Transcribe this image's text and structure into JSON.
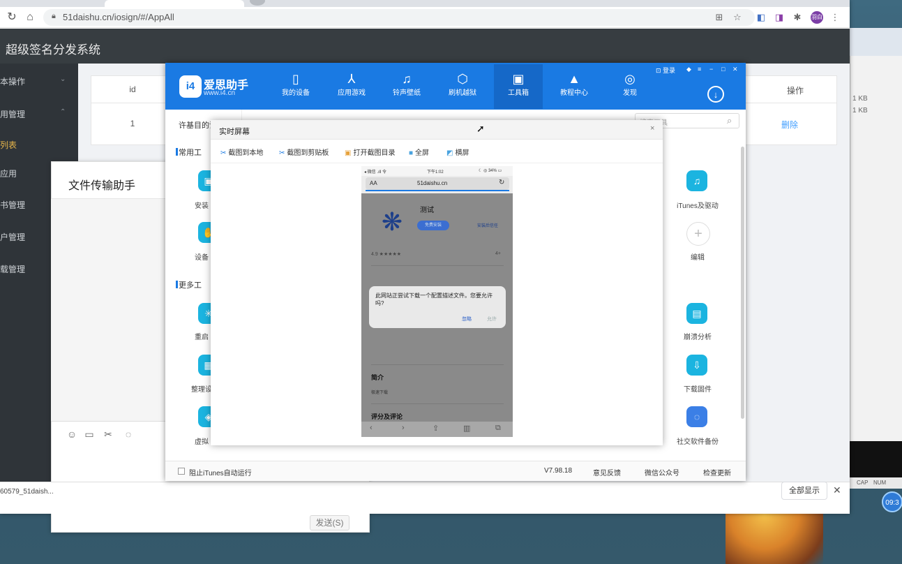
{
  "browser": {
    "url": "51daishu.cn/iosign/#/AppAll",
    "lock_icon": "lock-icon",
    "avatar_text": "羽白",
    "icons": [
      "back-icon",
      "reload-icon",
      "home-icon",
      "translate-icon",
      "star-icon",
      "extension-icon",
      "profile-icon",
      "menu-icon"
    ]
  },
  "web_app": {
    "title": "超级签名分发系统",
    "sidebar": [
      {
        "label": "本操作",
        "arrow": "⌄"
      },
      {
        "label": "用管理",
        "arrow": "⌃"
      },
      {
        "label": "列表",
        "active": true
      },
      {
        "label": "应用"
      },
      {
        "label": "书管理"
      },
      {
        "label": "户管理"
      },
      {
        "label": "载管理"
      }
    ],
    "table": {
      "headers": {
        "id": "id",
        "actions": "操作"
      },
      "rows": [
        {
          "id": "1",
          "action": "删除"
        }
      ]
    }
  },
  "file_transfer": {
    "title": "文件传输助手",
    "send_label": "发送(S)",
    "tool_icons": [
      "emoji-icon",
      "folder-icon",
      "scissors-icon",
      "chat-icon"
    ]
  },
  "download_bar": {
    "file": "60579_51daish...",
    "show_all": "全部显示",
    "close": "✕"
  },
  "right_window": {
    "sizes": [
      "1 KB",
      "1 KB"
    ],
    "status": [
      "CAP",
      "NUM"
    ],
    "clock": "09:3"
  },
  "i4": {
    "brand": "爱思助手",
    "url": "www.i4.cn",
    "logo": "i4",
    "window_controls": "登录",
    "nav": [
      {
        "label": "我的设备",
        "icon": "▯"
      },
      {
        "label": "应用游戏",
        "icon": "⅄"
      },
      {
        "label": "铃声壁纸",
        "icon": "♫"
      },
      {
        "label": "刷机越狱",
        "icon": "⬡"
      },
      {
        "label": "工具箱",
        "icon": "▣",
        "active": true
      },
      {
        "label": "教程中心",
        "icon": "▲"
      },
      {
        "label": "发现",
        "icon": "◎"
      }
    ],
    "side_tab": "许基目的讯",
    "search_placeholder": "搜索工具",
    "sections": {
      "common": "常用工",
      "more": "更多工"
    },
    "left_tiles": [
      "安装",
      "设备",
      "重启",
      "整理设",
      "虚拟"
    ],
    "right_tiles": [
      "iTunes及驱动",
      "编辑",
      "崩溃分析",
      "下载固件",
      "社交软件备份"
    ],
    "footer": {
      "checkbox_label": "阻止iTunes自动运行",
      "version": "V7.98.18",
      "feedback": "意见反馈",
      "wechat": "微信公众号",
      "update": "检查更新"
    }
  },
  "realtime_screen": {
    "title": "实时屏幕",
    "close": "×",
    "tools": [
      {
        "label": "截图到本地",
        "icon": "✂"
      },
      {
        "label": "截图到剪贴板",
        "icon": "✂"
      },
      {
        "label": "打开截图目录",
        "icon": "▣"
      },
      {
        "label": "全屏",
        "icon": "■"
      },
      {
        "label": "横屏",
        "icon": "◩"
      }
    ]
  },
  "phone": {
    "status_left": "◂ 微信 .ıll 令",
    "status_center": "下午1:02",
    "status_right": "☾ ◎ 34% ▭",
    "aa": "AA",
    "url": "51daishu.cn",
    "app_name": "测试",
    "install_btn": "免费安装",
    "trust_btn": "安装后信任",
    "rating": "4.9 ★★★★★",
    "age": "4+",
    "dialog_text": "此网站正尝试下载一个配置描述文件。您要允许吗?",
    "dialog_ignore": "忽略",
    "dialog_allow": "允许",
    "intro": "简介",
    "intro_sub": "极速下载",
    "reviews": "评分及评论"
  }
}
